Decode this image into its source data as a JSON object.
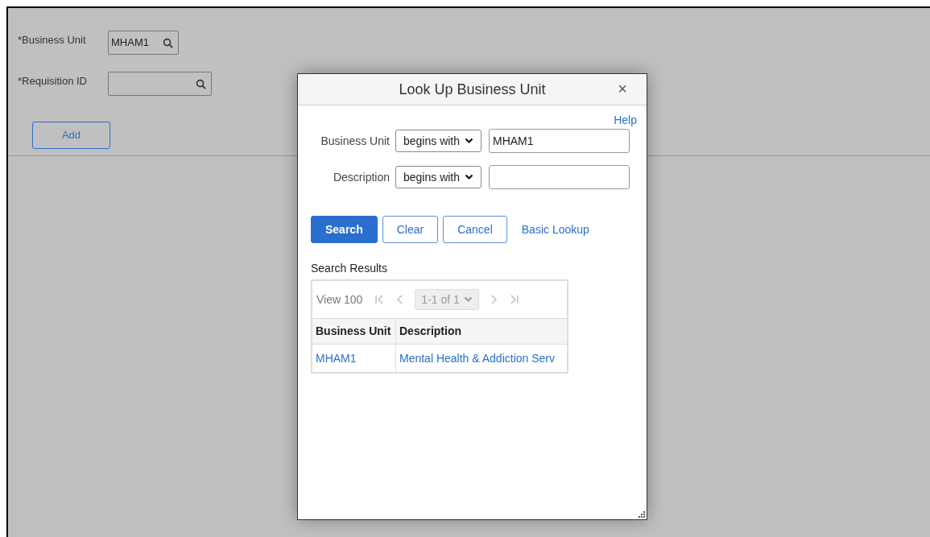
{
  "form": {
    "fields": [
      {
        "label": "*Business Unit",
        "value": "MHAM1"
      },
      {
        "label": "*Requisition ID"
      }
    ],
    "add_button": "Add"
  },
  "dialog": {
    "title": "Look Up Business Unit",
    "close": "×",
    "help": "Help",
    "criteria": [
      {
        "label": "Business Unit",
        "operator": "begins with",
        "value": "MHAM1"
      },
      {
        "label": "Description",
        "operator": "begins with"
      }
    ],
    "buttons": [
      {
        "label": "Search",
        "kind": "primary"
      },
      {
        "label": "Clear",
        "kind": "secondary"
      },
      {
        "label": "Cancel",
        "kind": "secondary"
      },
      {
        "label": "Basic Lookup",
        "kind": "link"
      }
    ],
    "results": {
      "title": "Search Results",
      "view": "View 100",
      "pager": "1-1 of 1",
      "nav_disabled": true,
      "columns": [
        "Business Unit",
        "Description"
      ],
      "rows": [
        [
          "MHAM1",
          "Mental Health & Addiction Serv"
        ]
      ]
    }
  }
}
